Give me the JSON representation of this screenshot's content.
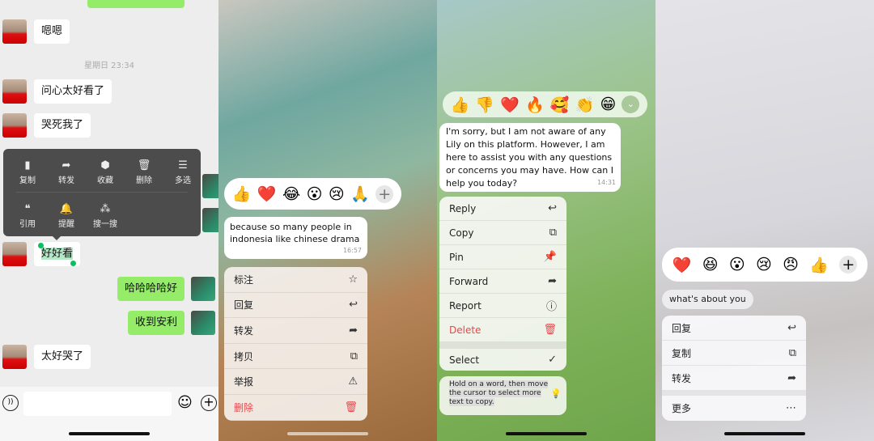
{
  "panel1": {
    "messages": [
      {
        "side": "left",
        "text": "嗯嗯"
      },
      {
        "side": "left",
        "text": "问心太好看了"
      },
      {
        "side": "left",
        "text": "哭死我了"
      },
      {
        "side": "left",
        "text": "好好看",
        "selected": true
      },
      {
        "side": "right",
        "text": "哈哈哈哈好"
      },
      {
        "side": "right",
        "text": "收到安利"
      },
      {
        "side": "left",
        "text": "太好哭了"
      }
    ],
    "timestamp": "星期日 23:34",
    "menu": [
      {
        "label": "复制",
        "icon": "document-icon",
        "glyph": "▮"
      },
      {
        "label": "转发",
        "icon": "forward-icon",
        "glyph": "➦"
      },
      {
        "label": "收藏",
        "icon": "cube-icon",
        "glyph": "⬢"
      },
      {
        "label": "删除",
        "icon": "trash-icon",
        "glyph": "🗑"
      },
      {
        "label": "多选",
        "icon": "multiselect-icon",
        "glyph": "☰"
      },
      {
        "label": "引用",
        "icon": "quote-icon",
        "glyph": "❝"
      },
      {
        "label": "提醒",
        "icon": "bell-icon",
        "glyph": "🔔"
      },
      {
        "label": "搜一搜",
        "icon": "search-spark-icon",
        "glyph": "⁂"
      }
    ],
    "selection_color": "#07c160"
  },
  "panel2": {
    "reactions": [
      "👍",
      "❤️",
      "😂",
      "😮",
      "😢",
      "🙏"
    ],
    "message": {
      "text": "because so many people in indonesia like chinese drama",
      "time": "16:57"
    },
    "menu": [
      {
        "label": "标注",
        "glyph": "☆",
        "icon": "star-icon"
      },
      {
        "label": "回复",
        "glyph": "↩",
        "icon": "reply-icon"
      },
      {
        "label": "转发",
        "glyph": "➦",
        "icon": "forward-icon"
      },
      {
        "label": "拷贝",
        "glyph": "⧉",
        "icon": "copy-icon"
      },
      {
        "label": "举报",
        "glyph": "⚠",
        "icon": "warning-icon"
      },
      {
        "label": "删除",
        "glyph": "🗑",
        "icon": "trash-icon",
        "destructive": true
      }
    ]
  },
  "panel3": {
    "reactions": [
      "👍",
      "👎",
      "❤️",
      "🔥",
      "🥰",
      "👏",
      "😁"
    ],
    "message": {
      "text": "I'm sorry, but I am not aware of any Lily on this platform. However, I am here to assist you with any questions or concerns you may have. How can I help you today?",
      "time": "14:31"
    },
    "menu": [
      {
        "label": "Reply",
        "glyph": "↩",
        "icon": "reply-icon"
      },
      {
        "label": "Copy",
        "glyph": "⧉",
        "icon": "copy-icon"
      },
      {
        "label": "Pin",
        "glyph": "📌",
        "icon": "pin-icon"
      },
      {
        "label": "Forward",
        "glyph": "➦",
        "icon": "forward-icon"
      },
      {
        "label": "Report",
        "glyph": "ⓘ",
        "icon": "report-icon"
      },
      {
        "label": "Delete",
        "glyph": "🗑",
        "icon": "trash-icon",
        "destructive": true
      }
    ],
    "select": {
      "label": "Select",
      "glyph": "✓"
    },
    "tip": "Hold on a word, then move the cursor to select more text to copy."
  },
  "panel4": {
    "reactions": [
      "❤️",
      "😆",
      "😮",
      "😢",
      "😠",
      "👍"
    ],
    "message": {
      "text": "what's about you"
    },
    "menu": [
      {
        "label": "回复",
        "glyph": "↩",
        "icon": "reply-icon"
      },
      {
        "label": "复制",
        "glyph": "⧉",
        "icon": "copy-icon"
      },
      {
        "label": "转发",
        "glyph": "➦",
        "icon": "forward-icon"
      }
    ],
    "more": {
      "label": "更多",
      "glyph": "⋯"
    }
  }
}
